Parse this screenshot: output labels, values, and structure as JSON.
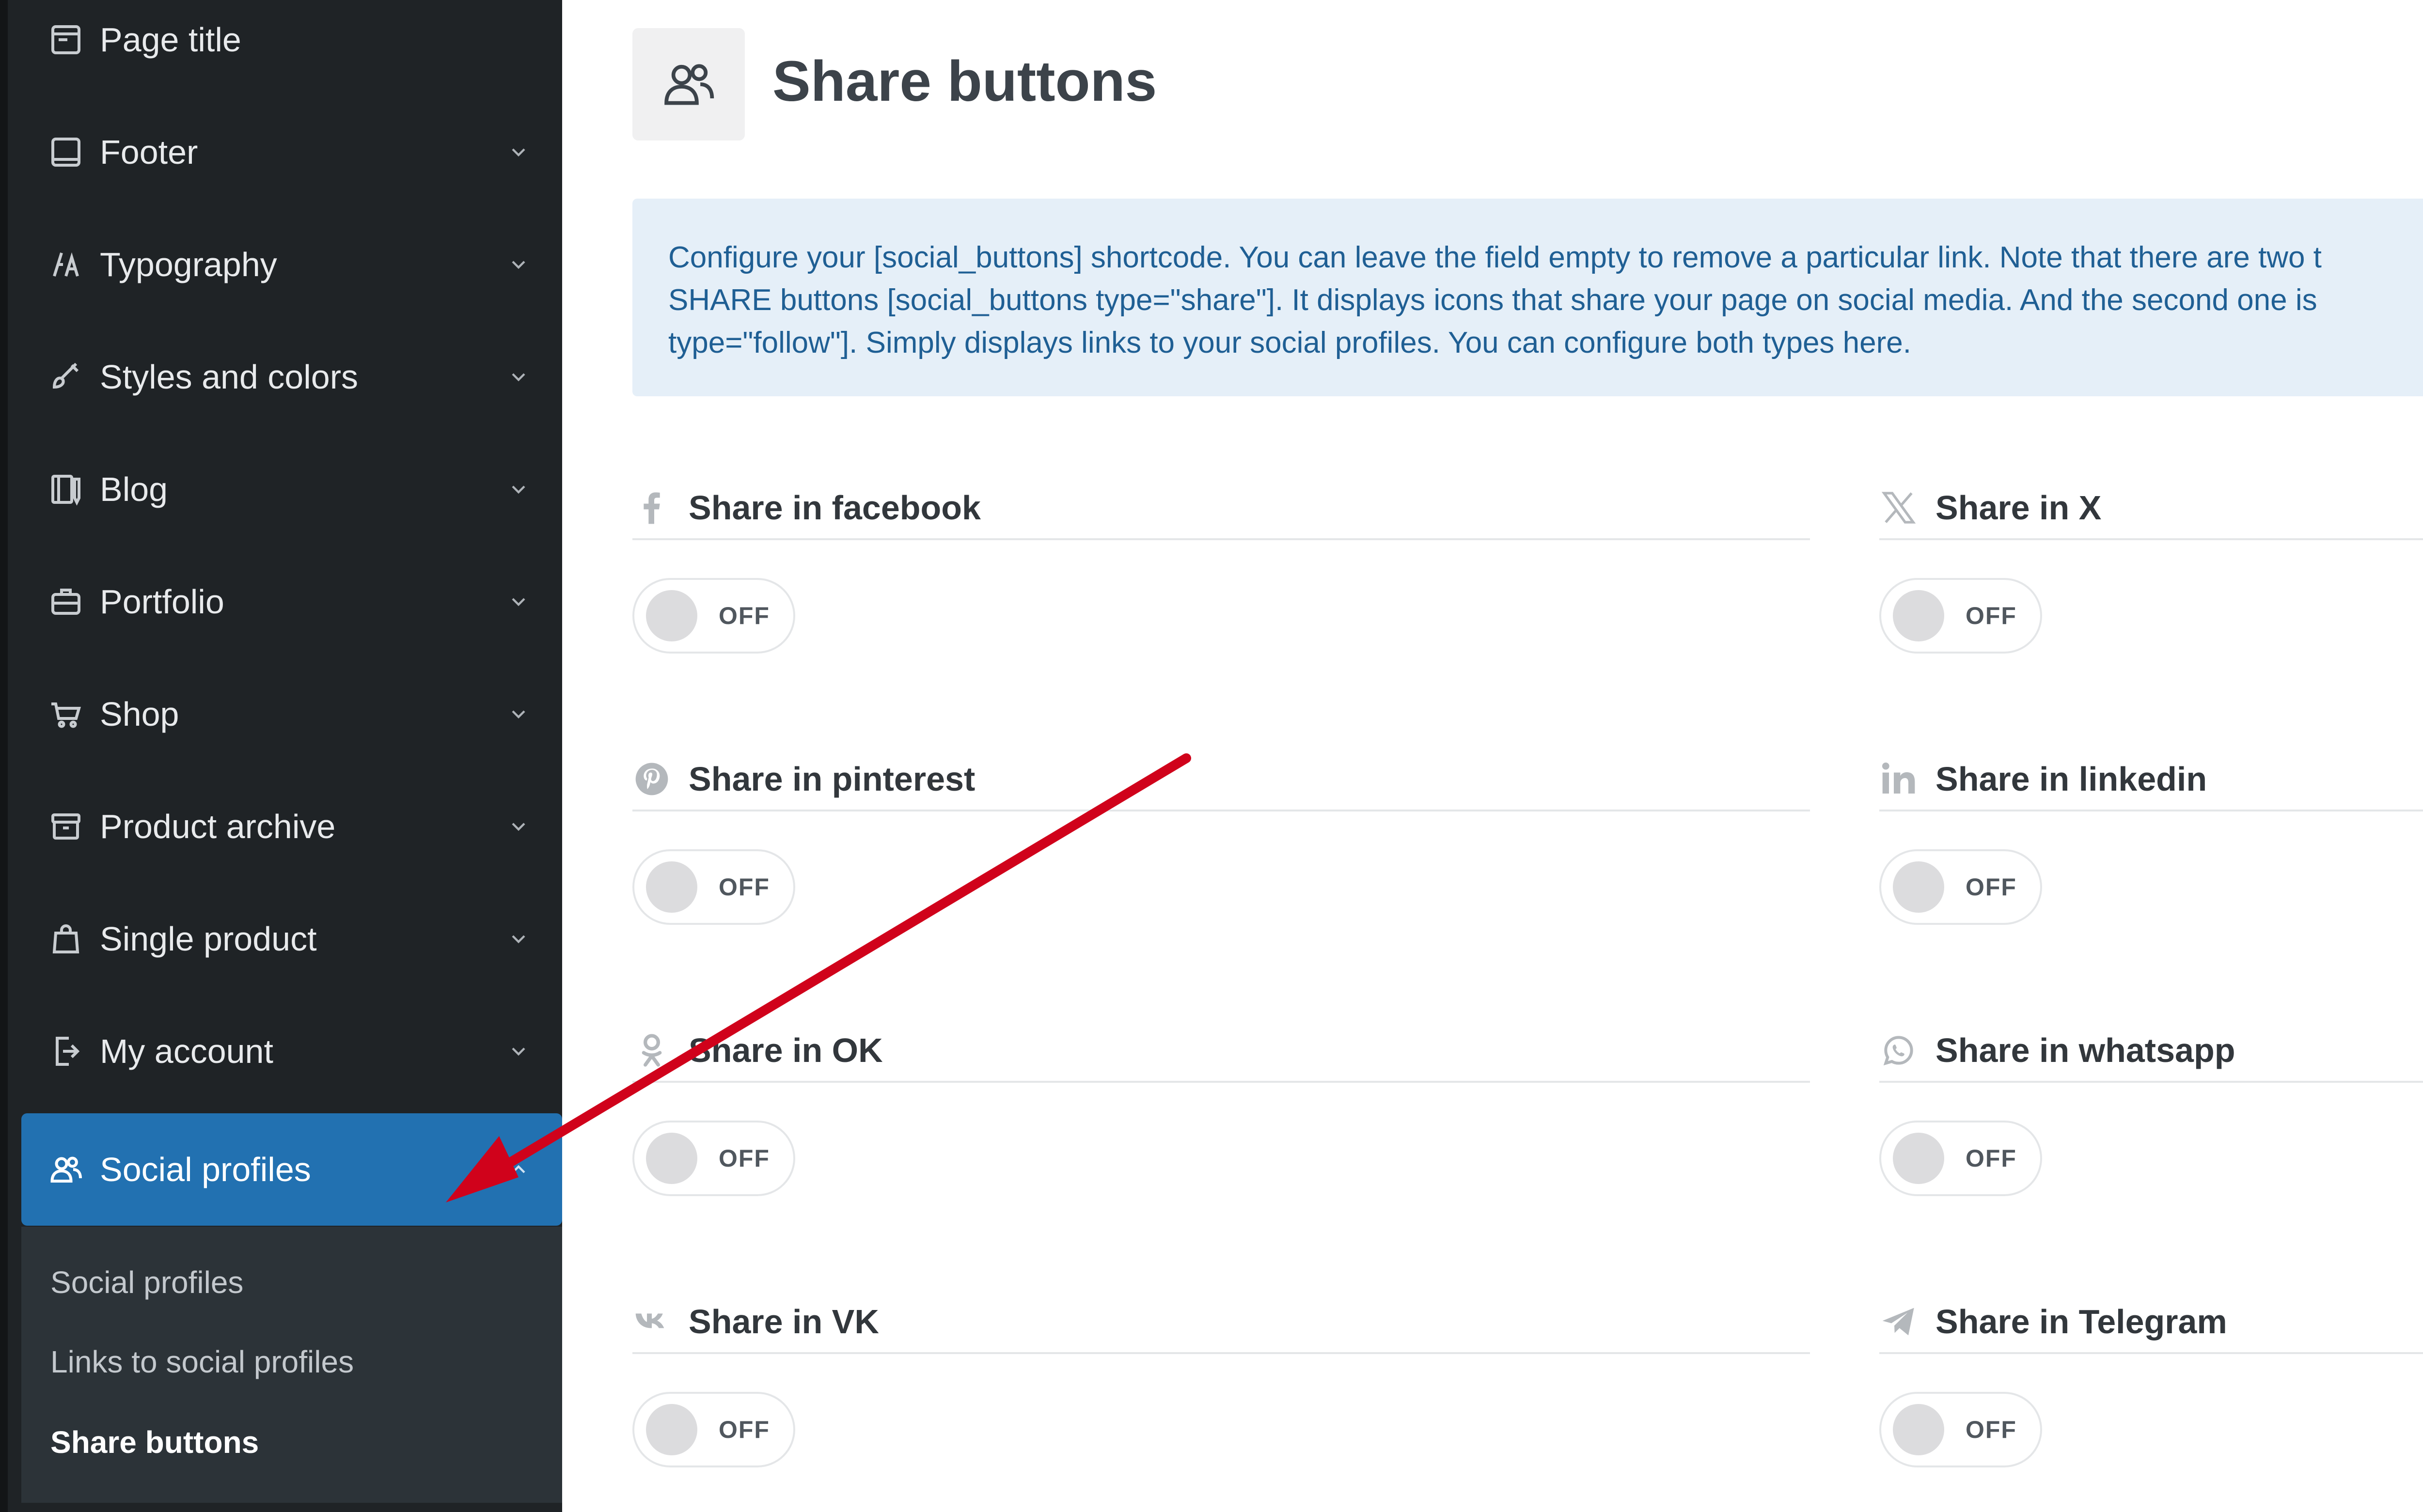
{
  "sidebar": {
    "items": [
      {
        "label": "Page title",
        "icon": "page-title-icon"
      },
      {
        "label": "Footer",
        "icon": "footer-icon"
      },
      {
        "label": "Typography",
        "icon": "typography-icon"
      },
      {
        "label": "Styles and colors",
        "icon": "brush-icon"
      },
      {
        "label": "Blog",
        "icon": "blog-icon"
      },
      {
        "label": "Portfolio",
        "icon": "briefcase-icon"
      },
      {
        "label": "Shop",
        "icon": "cart-icon"
      },
      {
        "label": "Product archive",
        "icon": "archive-icon"
      },
      {
        "label": "Single product",
        "icon": "bag-icon"
      },
      {
        "label": "My account",
        "icon": "login-icon"
      },
      {
        "label": "Social profiles",
        "icon": "users-icon",
        "active": true
      }
    ],
    "submenu": [
      {
        "label": "Social profiles"
      },
      {
        "label": "Links to social profiles"
      },
      {
        "label": "Share buttons",
        "current": true
      }
    ]
  },
  "header": {
    "title": "Share buttons",
    "icon": "users-icon"
  },
  "notice": {
    "lines": [
      "Configure your [social_buttons] shortcode. You can leave the field empty to remove a particular link. Note that there are two t",
      "SHARE buttons [social_buttons type=\"share\"]. It displays icons that share your page on social media. And the second one is",
      "type=\"follow\"]. Simply displays links to your social profiles. You can configure both types here."
    ]
  },
  "fields": [
    {
      "label": "Share in facebook",
      "icon": "facebook-icon",
      "state": "OFF"
    },
    {
      "label": "Share in X",
      "icon": "x-icon",
      "state": "OFF"
    },
    {
      "label": "Share in pinterest",
      "icon": "pinterest-icon",
      "state": "OFF"
    },
    {
      "label": "Share in linkedin",
      "icon": "linkedin-icon",
      "state": "OFF"
    },
    {
      "label": "Share in OK",
      "icon": "ok-icon",
      "state": "OFF"
    },
    {
      "label": "Share in whatsapp",
      "icon": "whatsapp-icon",
      "state": "OFF"
    },
    {
      "label": "Share in VK",
      "icon": "vk-icon",
      "state": "OFF"
    },
    {
      "label": "Share in Telegram",
      "icon": "telegram-icon",
      "state": "OFF"
    }
  ],
  "colors": {
    "sidebar_bg": "#1f2326",
    "active_bg": "#2271b1",
    "notice_bg": "#e5eff8",
    "notice_text": "#1f5f94",
    "annotation_arrow": "#d0021b"
  }
}
